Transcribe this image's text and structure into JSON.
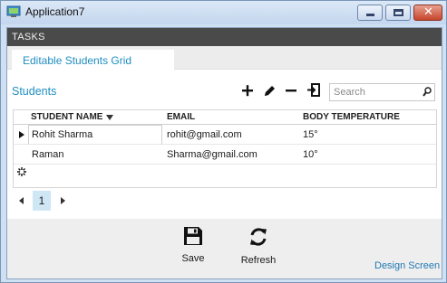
{
  "window": {
    "title": "Application7",
    "close_glyph": "✕"
  },
  "tasks_bar": {
    "label": "TASKS"
  },
  "tabs": [
    {
      "label": "Editable Students Grid",
      "selected": true
    }
  ],
  "section": {
    "title": "Students"
  },
  "toolbar": {
    "icons": [
      "plus-icon",
      "pencil-icon",
      "minus-icon",
      "export-icon"
    ]
  },
  "search": {
    "placeholder": "Search",
    "value": ""
  },
  "grid": {
    "columns": [
      {
        "label": "STUDENT NAME",
        "sorted": "desc"
      },
      {
        "label": "EMAIL"
      },
      {
        "label": "BODY TEMPERATURE"
      }
    ],
    "rows": [
      {
        "name": "Rohit Sharma",
        "email": "rohit@gmail.com",
        "temperature": "15°",
        "current": true
      },
      {
        "name": "Raman",
        "email": "Sharma@gmail.com",
        "temperature": "10°",
        "current": false
      }
    ]
  },
  "pager": {
    "current_page": "1"
  },
  "actions": {
    "save_label": "Save",
    "refresh_label": "Refresh",
    "design_link": "Design Screen"
  },
  "colors": {
    "accent": "#1f8ec0",
    "tasks_bar_bg": "#4a4a4a",
    "bottom_bar_bg": "#eeeeee",
    "page_highlight": "#cfe7f5"
  }
}
